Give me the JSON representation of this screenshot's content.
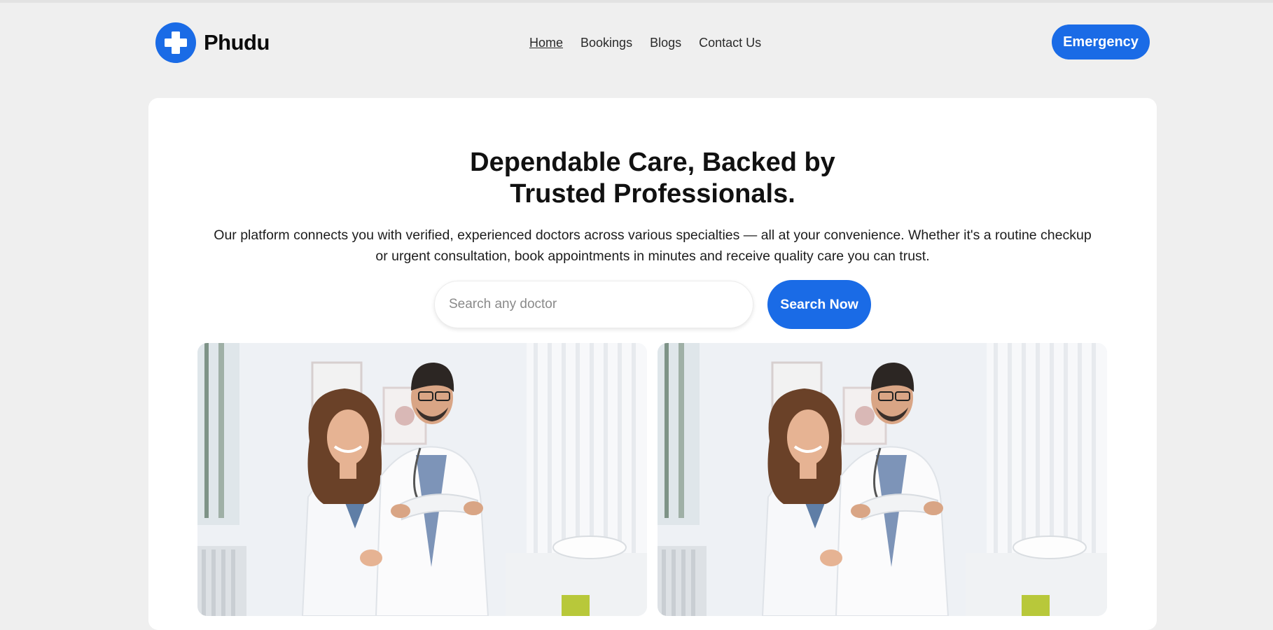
{
  "brand": {
    "name": "Phudu",
    "logo_icon": "medical-cross-icon",
    "accent_color": "#1a6be6"
  },
  "nav": {
    "links": [
      {
        "label": "Home",
        "active": true
      },
      {
        "label": "Bookings",
        "active": false
      },
      {
        "label": "Blogs",
        "active": false
      },
      {
        "label": "Contact Us",
        "active": false
      }
    ],
    "emergency_label": "Emergency"
  },
  "hero": {
    "title_line1": "Dependable Care, Backed by",
    "title_line2": "Trusted Professionals.",
    "description_line1": "Our platform connects you with verified, experienced doctors across various specialties — all at your convenience. Whether it's a routine checkup",
    "description_line2": "or urgent consultation, book appointments in minutes and receive quality care you can trust.",
    "search": {
      "placeholder": "Search any doctor",
      "value": "",
      "button_label": "Search Now"
    },
    "images": [
      {
        "subject": "two-doctors-photo"
      },
      {
        "subject": "two-doctors-photo"
      }
    ]
  }
}
